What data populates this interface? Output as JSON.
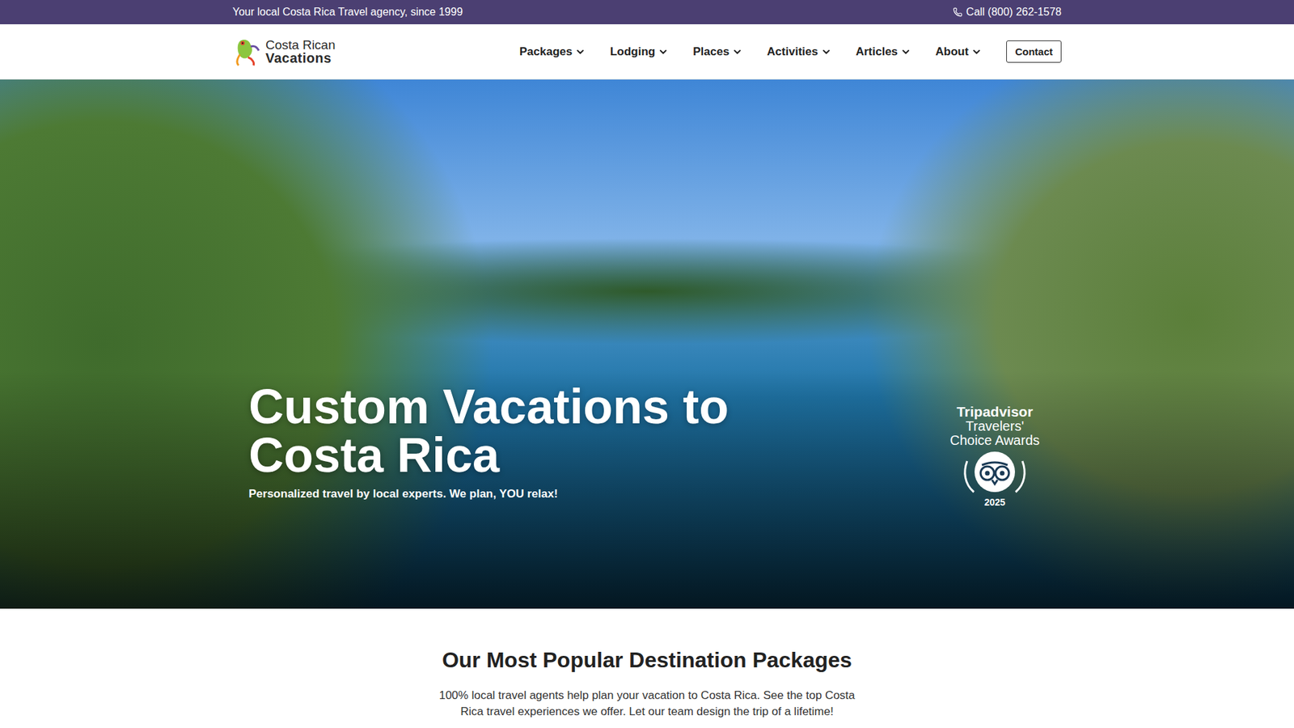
{
  "top_bar": {
    "tagline": "Your local Costa Rica Travel agency, since 1999",
    "phone": "Call (800) 262-1578"
  },
  "logo": {
    "line1": "Costa Rican",
    "line2": "Vacations"
  },
  "nav": {
    "items": [
      {
        "label": "Packages"
      },
      {
        "label": "Lodging"
      },
      {
        "label": "Places"
      },
      {
        "label": "Activities"
      },
      {
        "label": "Articles"
      },
      {
        "label": "About"
      }
    ],
    "contact": "Contact"
  },
  "hero": {
    "title": "Custom Vacations to Costa Rica",
    "subtitle": "Personalized travel by local experts. We plan, YOU relax!",
    "award": {
      "brand": "Tripadvisor",
      "line1": "Travelers'",
      "line2": "Choice Awards",
      "year": "2025"
    }
  },
  "section": {
    "title": "Our Most Popular Destination Packages",
    "description": "100% local travel agents help plan your vacation to Costa Rica. See the top Costa Rica travel experiences we offer. Let our team design the trip of a lifetime!"
  }
}
